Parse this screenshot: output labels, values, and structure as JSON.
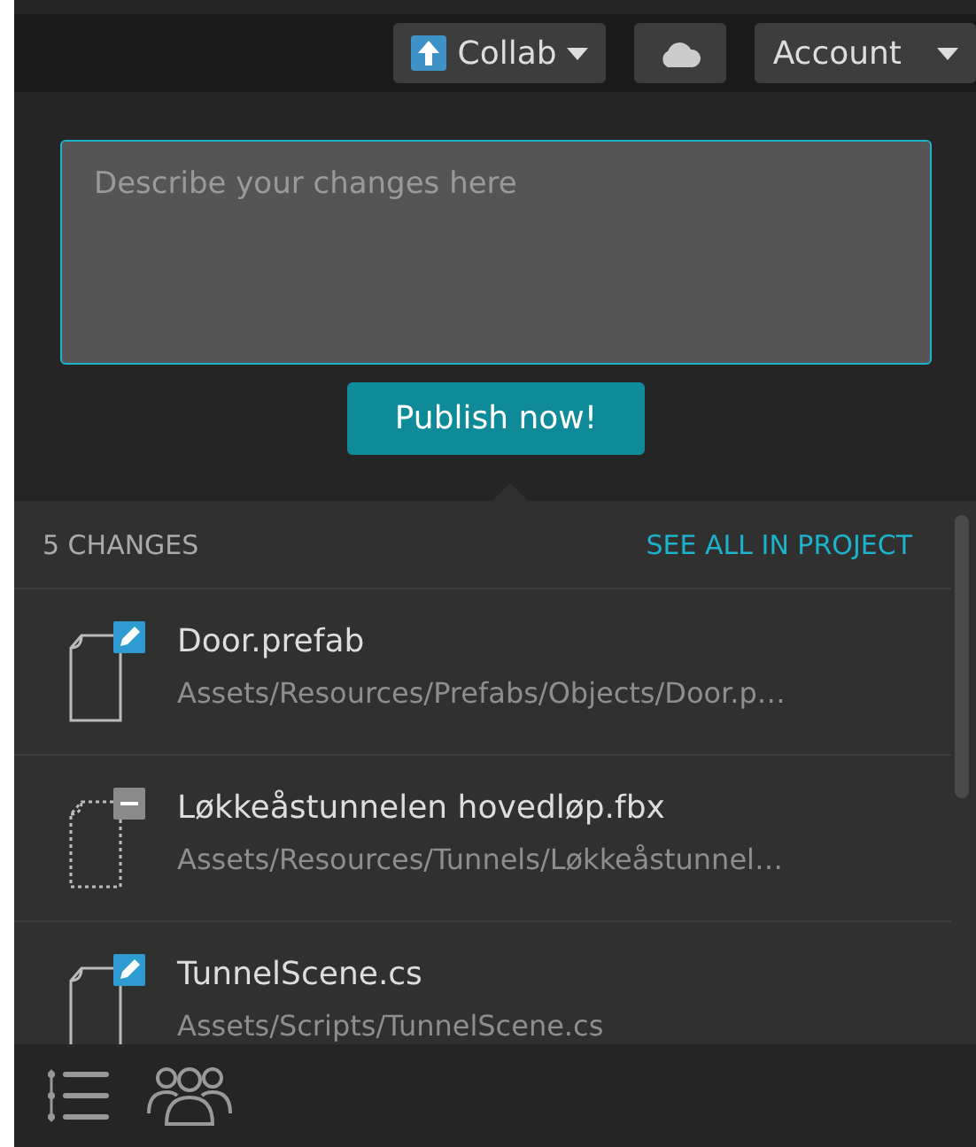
{
  "toolbar": {
    "collab_label": "Collab",
    "account_label": "Account"
  },
  "publish": {
    "placeholder": "Describe your changes here",
    "button": "Publish now!"
  },
  "changes": {
    "count_label": "5 CHANGES",
    "see_all_link": "SEE ALL IN PROJECT",
    "items": [
      {
        "kind": "modified",
        "name": "Door.prefab",
        "path": "Assets/Resources/Prefabs/Objects/Door.p…"
      },
      {
        "kind": "deleted",
        "name": "Løkkeåstunnelen hovedløp.fbx",
        "path": "Assets/Resources/Tunnels/Løkkeåstunnel…"
      },
      {
        "kind": "modified",
        "name": "TunnelScene.cs",
        "path": "Assets/Scripts/TunnelScene.cs"
      }
    ]
  }
}
